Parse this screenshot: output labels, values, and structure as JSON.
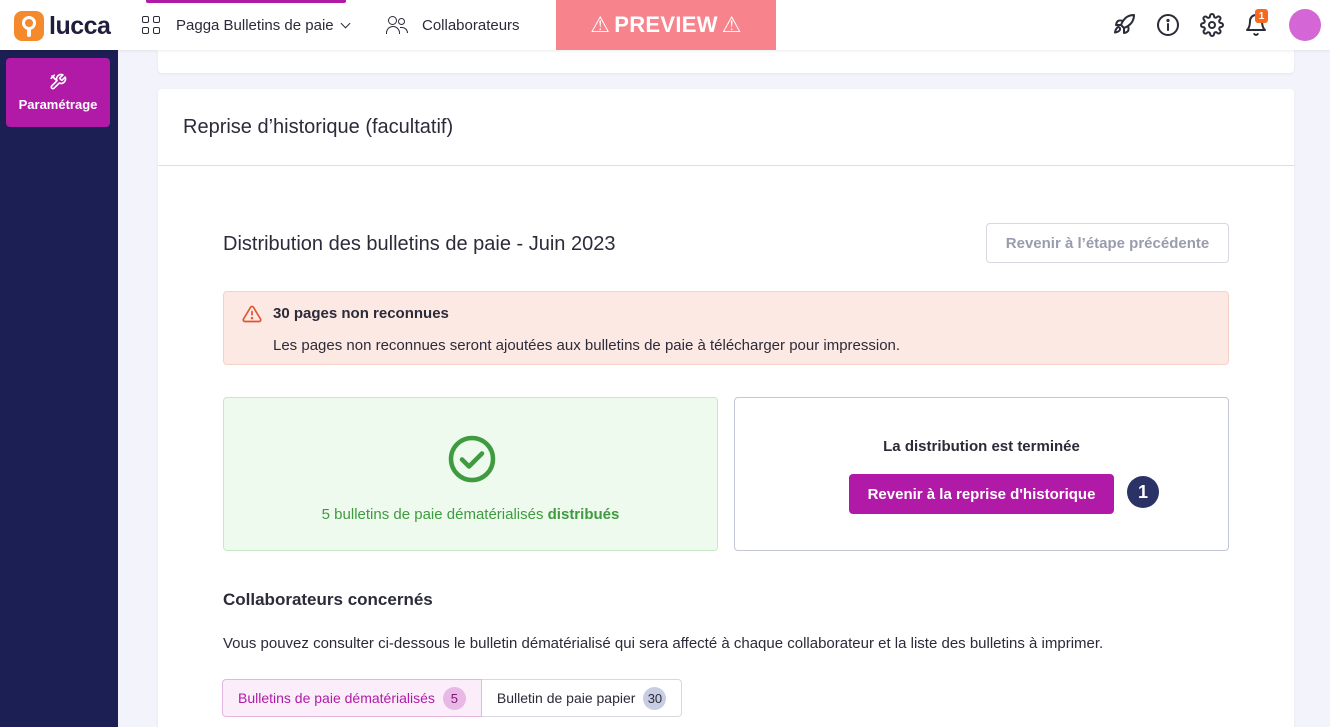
{
  "app": {
    "logo_text": "lucca"
  },
  "topbar": {
    "apps_menu_label": "Pagga Bulletins de paie",
    "collaborators_label": "Collaborateurs",
    "preview_label": "PREVIEW",
    "notification_count": "1",
    "icons": [
      "rocket-icon",
      "info-icon",
      "gear-icon",
      "bell-icon"
    ]
  },
  "sidebar": {
    "items": [
      {
        "label": "Paramétrage",
        "icon": "tools-icon"
      }
    ]
  },
  "card": {
    "header_title": "Reprise d’historique (facultatif)",
    "section_title": "Distribution des bulletins de paie - Juin 2023",
    "back_button_label": "Revenir à l’étape précédente"
  },
  "alert": {
    "title": "30 pages non reconnues",
    "text": "Les pages non reconnues seront ajoutées aux bulletins de paie à télécharger pour impression."
  },
  "success_box": {
    "text": "5 bulletins de paie dématérialisés ",
    "text_bold": "distribués"
  },
  "done_box": {
    "text": "La distribution est terminée",
    "button_label": "Revenir à la reprise d'historique",
    "step_number": "1"
  },
  "collaborators": {
    "title": "Collaborateurs concernés",
    "description": "Vous pouvez consulter ci-dessous le bulletin dématérialisé qui sera affecté à chaque collaborateur et la liste des bulletins à imprimer."
  },
  "tabs": [
    {
      "label": "Bulletins de paie dématérialisés",
      "count": "5"
    },
    {
      "label": "Bulletin de paie papier",
      "count": "30"
    }
  ],
  "colors": {
    "accent": "#b01aa7",
    "sidebar": "#1c1f53",
    "preview": "#f7838d",
    "success": "#3f9b3f"
  }
}
